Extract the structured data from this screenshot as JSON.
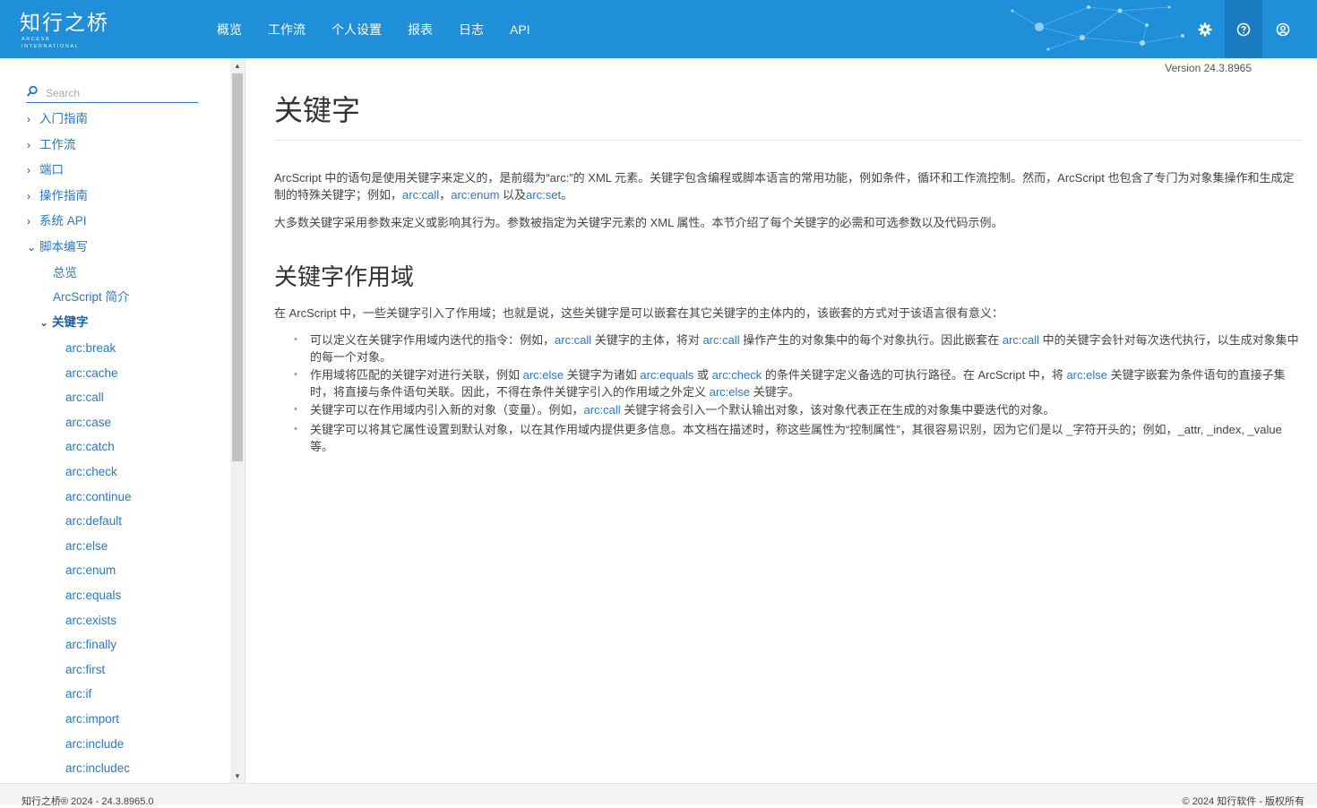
{
  "header": {
    "brand_main": "知行之桥",
    "brand_sub": "ARCESB INTERNATIONAL",
    "nav": [
      "概览",
      "工作流",
      "个人设置",
      "报表",
      "日志",
      "API"
    ],
    "icons": [
      "gear-icon",
      "help-icon",
      "user-icon"
    ],
    "accent": "#1e8fd8"
  },
  "version": "Version 24.3.8965",
  "sidebar": {
    "search_placeholder": "Search",
    "top_items": [
      "入门指南",
      "工作流",
      "端口",
      "操作指南",
      "系统 API",
      "脚本编写"
    ],
    "sub_items": [
      "总览",
      "ArcScript 简介",
      "关键字"
    ],
    "keywords": [
      "arc:break",
      "arc:cache",
      "arc:call",
      "arc:case",
      "arc:catch",
      "arc:check",
      "arc:continue",
      "arc:default",
      "arc:else",
      "arc:enum",
      "arc:equals",
      "arc:exists",
      "arc:finally",
      "arc:first",
      "arc:if",
      "arc:import",
      "arc:include",
      "arc:includec"
    ]
  },
  "main": {
    "title": "关键字",
    "intro1_a": "ArcScript 中的语句是使用关键字来定义的，是前缀为“arc:”的 XML 元素。关键字包含编程或脚本语言的常用功能，例如条件，循环和工作流控制。然而，ArcScript 也包含了专门为对象集操作和生成定制的特殊关键字；例如，",
    "intro1_link1": "arc:call",
    "intro1_sep": "，",
    "intro1_link2": "arc:enum",
    "intro1_and": " 以及",
    "intro1_link3": "arc:set",
    "intro1_end": "。",
    "intro2": "大多数关键字采用参数来定义或影响其行为。参数被指定为关键字元素的 XML 属性。本节介绍了每个关键字的必需和可选参数以及代码示例。",
    "scope_title": "关键字作用域",
    "scope_intro": "在 ArcScript 中，一些关键字引入了作用域；也就是说，这些关键字是可以嵌套在其它关键字的主体内的，该嵌套的方式对于该语言很有意义：",
    "b1": {
      "t1": "可以定义在关键字作用域内迭代的指令：例如，",
      "l1": "arc:call",
      "t2": " 关键字的主体，将对 ",
      "l2": "arc:call",
      "t3": " 操作产生的对象集中的每个对象执行。因此嵌套在 ",
      "l3": "arc:call",
      "t4": " 中的关键字会针对每次迭代执行，以生成对象集中的每一个对象。"
    },
    "b2": {
      "t1": "作用域将匹配的关键字对进行关联，例如 ",
      "l1": "arc:else",
      "t2": " 关键字为诸如 ",
      "l2": "arc:equals",
      "t3": " 或 ",
      "l3": "arc:check",
      "t4": " 的条件关键字定义备选的可执行路径。在 ArcScript 中，将 ",
      "l4": "arc:else",
      "t5": " 关键字嵌套为条件语句的直接子集时，将直接与条件语句关联。因此，不得在条件关键字引入的作用域之外定义 ",
      "l5": "arc:else",
      "t6": " 关键字。"
    },
    "b3": {
      "t1": "关键字可以在作用域内引入新的对象（变量）。例如，",
      "l1": "arc:call",
      "t2": " 关键字将会引入一个默认输出对象，该对象代表正在生成的对象集中要迭代的对象。"
    },
    "b4": {
      "t1": "关键字可以将其它属性设置到默认对象，以在其作用域内提供更多信息。本文档在描述时，称这些属性为“控制属性”，其很容易识别，因为它们是以 _字符开头的；例如，_attr, _index, _value 等。"
    }
  },
  "footer": {
    "left": "知行之桥® 2024 - 24.3.8965.0",
    "right": "© 2024 知行软件 - 版权所有"
  }
}
